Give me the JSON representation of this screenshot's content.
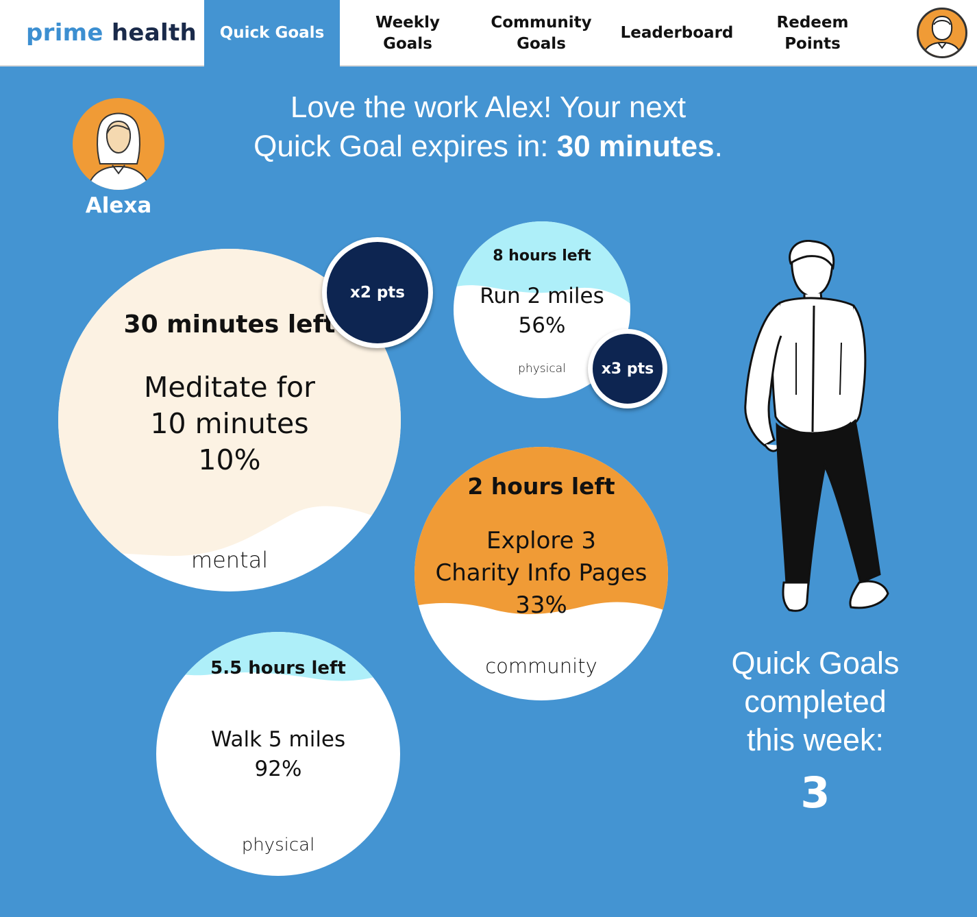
{
  "brand": {
    "part1": "prime",
    "part2": "health"
  },
  "nav": {
    "quick_goals": "Quick Goals",
    "weekly_goals": [
      "Weekly",
      "Goals"
    ],
    "community_goals": [
      "Community",
      "Goals"
    ],
    "leaderboard": "Leaderboard",
    "redeem_points": [
      "Redeem",
      "Points"
    ]
  },
  "greeting": {
    "line1": "Love the work Alex! Your next",
    "line2_prefix": "Quick Goal expires in: ",
    "line2_bold": "30 minutes",
    "line2_suffix": "."
  },
  "assistant": {
    "name": "Alexa"
  },
  "goals": [
    {
      "time_left": "30 minutes left",
      "title": [
        "Meditate for",
        "10 minutes"
      ],
      "progress": "10%",
      "category": "mental",
      "bonus": "x2 pts"
    },
    {
      "time_left": "8 hours left",
      "title": [
        "Run 2 miles"
      ],
      "progress": "56%",
      "category": "physical",
      "bonus": "x3 pts"
    },
    {
      "time_left": "2 hours left",
      "title": [
        "Explore 3",
        "Charity Info Pages"
      ],
      "progress": "33%",
      "category": "community"
    },
    {
      "time_left": "5.5 hours left",
      "title": [
        "Walk 5 miles"
      ],
      "progress": "92%",
      "category": "physical"
    }
  ],
  "completed": {
    "label": [
      "Quick Goals",
      "completed",
      "this week:"
    ],
    "count": "3"
  },
  "colors": {
    "background": "#4494d2",
    "navy": "#0d2551",
    "orange": "#f09b36",
    "cream": "#fcf2e3",
    "light_cyan": "#aeeff9"
  }
}
